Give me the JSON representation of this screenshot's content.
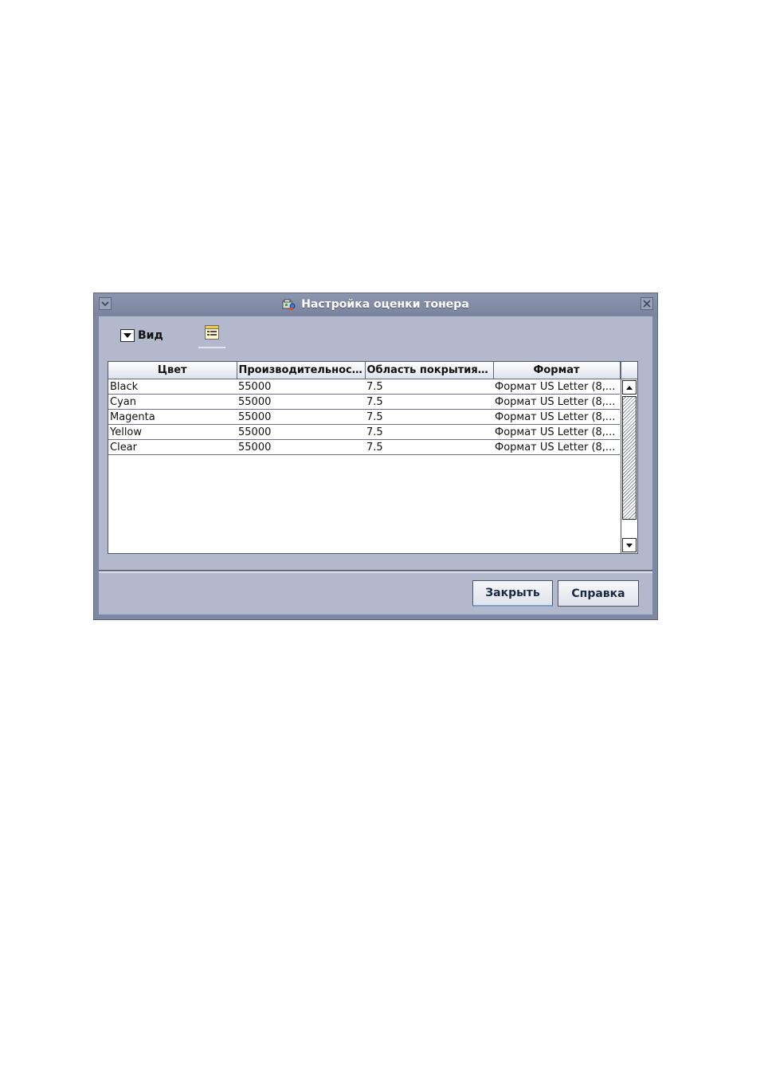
{
  "dialog": {
    "title": "Настройка оценки тонера",
    "title_icon": "toner-settings-icon"
  },
  "toolbar": {
    "view_label": "Вид",
    "view_dropdown_icon": "chevron-down-icon",
    "details_icon": "details-list-icon"
  },
  "table": {
    "columns": [
      "Цвет",
      "Производительност...",
      "Область покрытия (%)",
      "Формат"
    ],
    "rows": [
      [
        "Black",
        "55000",
        "7.5",
        "Формат US Letter (8,..."
      ],
      [
        "Cyan",
        "55000",
        "7.5",
        "Формат US Letter (8,..."
      ],
      [
        "Magenta",
        "55000",
        "7.5",
        "Формат US Letter (8,..."
      ],
      [
        "Yellow",
        "55000",
        "7.5",
        "Формат US Letter (8,..."
      ],
      [
        "Clear",
        "55000",
        "7.5",
        "Формат US Letter (8,..."
      ]
    ]
  },
  "buttons": {
    "close": "Закрыть",
    "help": "Справка"
  },
  "colors": {
    "window_frame": "#7f88a2",
    "client_bg": "#b2b9cc",
    "title_text": "#ffffff"
  }
}
